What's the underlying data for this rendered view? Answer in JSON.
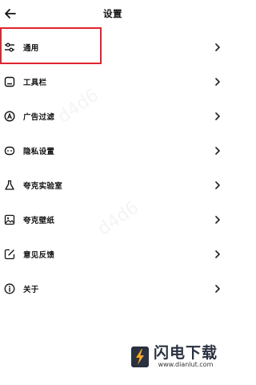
{
  "header": {
    "title": "设置"
  },
  "menu": {
    "items": [
      {
        "label": "通用",
        "icon": "sliders-icon"
      },
      {
        "label": "工具栏",
        "icon": "toolbar-icon"
      },
      {
        "label": "广告过滤",
        "icon": "ad-filter-icon"
      },
      {
        "label": "隐私设置",
        "icon": "privacy-mask-icon"
      },
      {
        "label": "夸克实验室",
        "icon": "flask-icon"
      },
      {
        "label": "夸克壁纸",
        "icon": "wallpaper-icon"
      },
      {
        "label": "意见反馈",
        "icon": "feedback-edit-icon"
      },
      {
        "label": "关于",
        "icon": "info-icon"
      }
    ]
  },
  "watermark": {
    "brand": "闪电下载",
    "url": "www.dianlut.com",
    "accent": "#f5a623"
  },
  "colors": {
    "highlight": "#e0242e"
  }
}
